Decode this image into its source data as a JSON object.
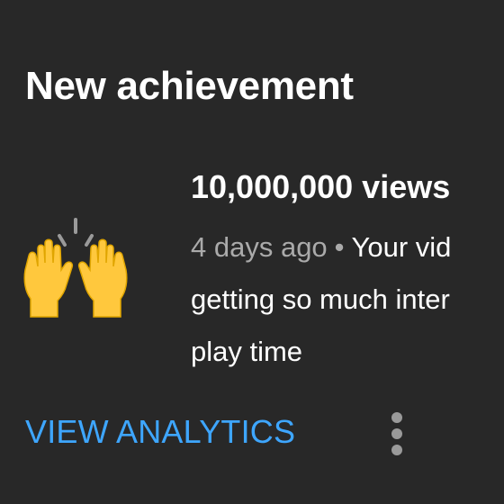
{
  "notification": {
    "heading": "New achievement",
    "icon": "raising-hands-emoji",
    "title": "10,000,000 views",
    "time": "4 days ago",
    "separator": "•",
    "message_line1": "Your vid",
    "message_line2": "getting so much inter",
    "message_line3": "play time",
    "action_label": "VIEW ANALYTICS",
    "menu_icon": "more-vertical-icon"
  },
  "colors": {
    "background": "#282828",
    "primary_text": "#ffffff",
    "secondary_text": "#aaaaaa",
    "accent": "#3ea6ff",
    "emoji": "#ffc83d"
  }
}
